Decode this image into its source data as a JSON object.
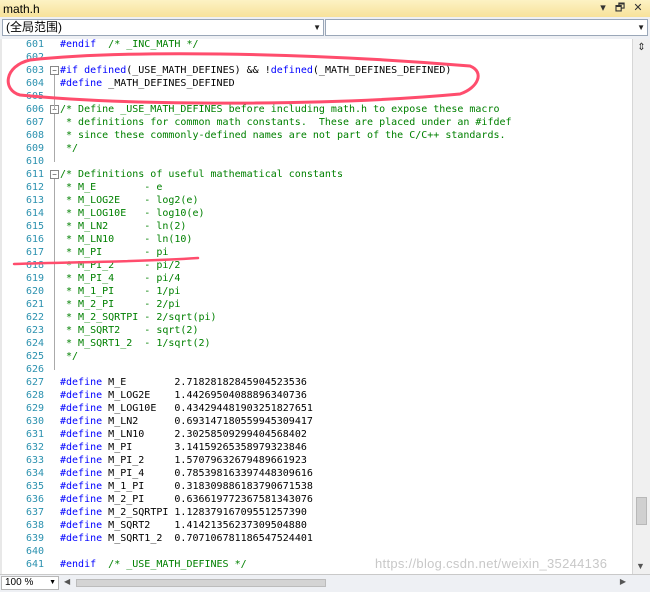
{
  "tab": {
    "title": "math.h",
    "controls": [
      "▾",
      "🗗",
      "✕"
    ]
  },
  "scope": {
    "left_value": "(全局范围)",
    "right_value": ""
  },
  "lines": [
    {
      "n": "601",
      "html": "<span class='kw'>#endif</span>  <span style='color:#008000'>/* _INC_MATH */</span>",
      "fold": ""
    },
    {
      "n": "602",
      "text": "",
      "fold": ""
    },
    {
      "n": "603",
      "html": "<span class='kw'>#if</span> <span class='kw'>defined</span>(_USE_MATH_DEFINES) &amp;&amp; !<span class='kw'>defined</span>(_MATH_DEFINES_DEFINED)",
      "fold": "−"
    },
    {
      "n": "604",
      "html": "<span class='kw'>#define</span> _MATH_DEFINES_DEFINED",
      "fold": ""
    },
    {
      "n": "605",
      "text": "",
      "fold": ""
    },
    {
      "n": "606",
      "text": "/* Define _USE_MATH_DEFINES before including math.h to expose these macro",
      "fold": "−",
      "comment": true
    },
    {
      "n": "607",
      "text": " * definitions for common math constants.  These are placed under an #ifdef",
      "comment": true
    },
    {
      "n": "608",
      "text": " * since these commonly-defined names are not part of the C/C++ standards.",
      "comment": true
    },
    {
      "n": "609",
      "text": " */",
      "comment": true
    },
    {
      "n": "610",
      "text": ""
    },
    {
      "n": "611",
      "text": "/* Definitions of useful mathematical constants",
      "fold": "−",
      "comment": true
    },
    {
      "n": "612",
      "text": " * M_E        - e",
      "comment": true
    },
    {
      "n": "613",
      "text": " * M_LOG2E    - log2(e)",
      "comment": true
    },
    {
      "n": "614",
      "text": " * M_LOG10E   - log10(e)",
      "comment": true
    },
    {
      "n": "615",
      "text": " * M_LN2      - ln(2)",
      "comment": true
    },
    {
      "n": "616",
      "text": " * M_LN10     - ln(10)",
      "comment": true
    },
    {
      "n": "617",
      "text": " * M_PI       - pi",
      "comment": true
    },
    {
      "n": "618",
      "text": " * M_PI_2     - pi/2",
      "comment": true
    },
    {
      "n": "619",
      "text": " * M_PI_4     - pi/4",
      "comment": true
    },
    {
      "n": "620",
      "text": " * M_1_PI     - 1/pi",
      "comment": true
    },
    {
      "n": "621",
      "text": " * M_2_PI     - 2/pi",
      "comment": true
    },
    {
      "n": "622",
      "text": " * M_2_SQRTPI - 2/sqrt(pi)",
      "comment": true
    },
    {
      "n": "623",
      "text": " * M_SQRT2    - sqrt(2)",
      "comment": true
    },
    {
      "n": "624",
      "text": " * M_SQRT1_2  - 1/sqrt(2)",
      "comment": true
    },
    {
      "n": "625",
      "text": " */",
      "comment": true
    },
    {
      "n": "626",
      "text": ""
    },
    {
      "n": "627",
      "html": "<span class='kw'>#define</span> M_E        2.71828182845904523536"
    },
    {
      "n": "628",
      "html": "<span class='kw'>#define</span> M_LOG2E    1.44269504088896340736"
    },
    {
      "n": "629",
      "html": "<span class='kw'>#define</span> M_LOG10E   0.434294481903251827651"
    },
    {
      "n": "630",
      "html": "<span class='kw'>#define</span> M_LN2      0.693147180559945309417"
    },
    {
      "n": "631",
      "html": "<span class='kw'>#define</span> M_LN10     2.30258509299404568402"
    },
    {
      "n": "632",
      "html": "<span class='kw'>#define</span> M_PI       3.14159265358979323846"
    },
    {
      "n": "633",
      "html": "<span class='kw'>#define</span> M_PI_2     1.57079632679489661923"
    },
    {
      "n": "634",
      "html": "<span class='kw'>#define</span> M_PI_4     0.785398163397448309616"
    },
    {
      "n": "635",
      "html": "<span class='kw'>#define</span> M_1_PI     0.318309886183790671538"
    },
    {
      "n": "636",
      "html": "<span class='kw'>#define</span> M_2_PI     0.636619772367581343076"
    },
    {
      "n": "637",
      "html": "<span class='kw'>#define</span> M_2_SQRTPI 1.12837916709551257390"
    },
    {
      "n": "638",
      "html": "<span class='kw'>#define</span> M_SQRT2    1.41421356237309504880"
    },
    {
      "n": "639",
      "html": "<span class='kw'>#define</span> M_SQRT1_2  0.707106781186547524401"
    },
    {
      "n": "640",
      "text": ""
    },
    {
      "n": "641",
      "html": "<span class='kw'>#endif</span>  <span style='color:#008000'>/* _USE_MATH_DEFINES */</span>"
    }
  ],
  "status": {
    "zoom": "100 %"
  },
  "watermark": "https://blog.csdn.net/weixin_35244136",
  "colors": {
    "keyword": "#0000ff",
    "comment": "#008000",
    "line_number": "#2b91af",
    "annotation": "#ff4d6d"
  }
}
